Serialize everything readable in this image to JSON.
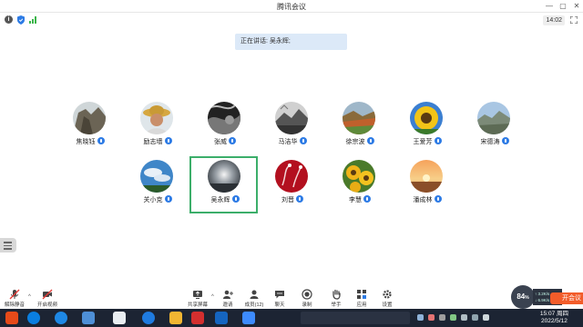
{
  "window": {
    "title": "腾讯会议"
  },
  "status": {
    "timer": "14:02"
  },
  "speaking": {
    "text": "正在讲话: 吴永辉;"
  },
  "participants": [
    {
      "name": "焦晓钰",
      "avatar": "cliff"
    },
    {
      "name": "励志墙",
      "avatar": "straw-hat-man"
    },
    {
      "name": "张威",
      "avatar": "bw-texture"
    },
    {
      "name": "马洁华",
      "avatar": "bw-landscape"
    },
    {
      "name": "徐宗波",
      "avatar": "autumn-hills"
    },
    {
      "name": "王爱芳",
      "avatar": "sunflower"
    },
    {
      "name": "宋德涛",
      "avatar": "mountain-sky"
    },
    {
      "name": "关小克",
      "avatar": "blue-sky"
    },
    {
      "name": "吴永辉",
      "avatar": "gray-glow"
    },
    {
      "name": "刘晋",
      "avatar": "red-art"
    },
    {
      "name": "李慧",
      "avatar": "sunflowers"
    },
    {
      "name": "潘成林",
      "avatar": "sunset"
    }
  ],
  "controls": {
    "unmute": "解除静音",
    "start_video": "开启视频",
    "share_screen": "共享屏幕",
    "invite": "邀请",
    "members": "成员(12)",
    "chat": "聊天",
    "record": "录制",
    "raise_hand": "举手",
    "apps": "应用",
    "settings": "设置"
  },
  "overlay": {
    "float_value": "84",
    "float_unit": "%",
    "panel_up": "↑ 3.2K/s",
    "panel_down": "↓ 6.9K/s",
    "meeting_button": "开会议"
  },
  "taskbar": {
    "time": "15:07 周四",
    "date": "2022/5/12"
  },
  "colors": {
    "accent": "#2d7be5",
    "selected_border": "#3cae6a",
    "meeting_orange": "#f25c2a",
    "taskbar": "#1c2433"
  }
}
